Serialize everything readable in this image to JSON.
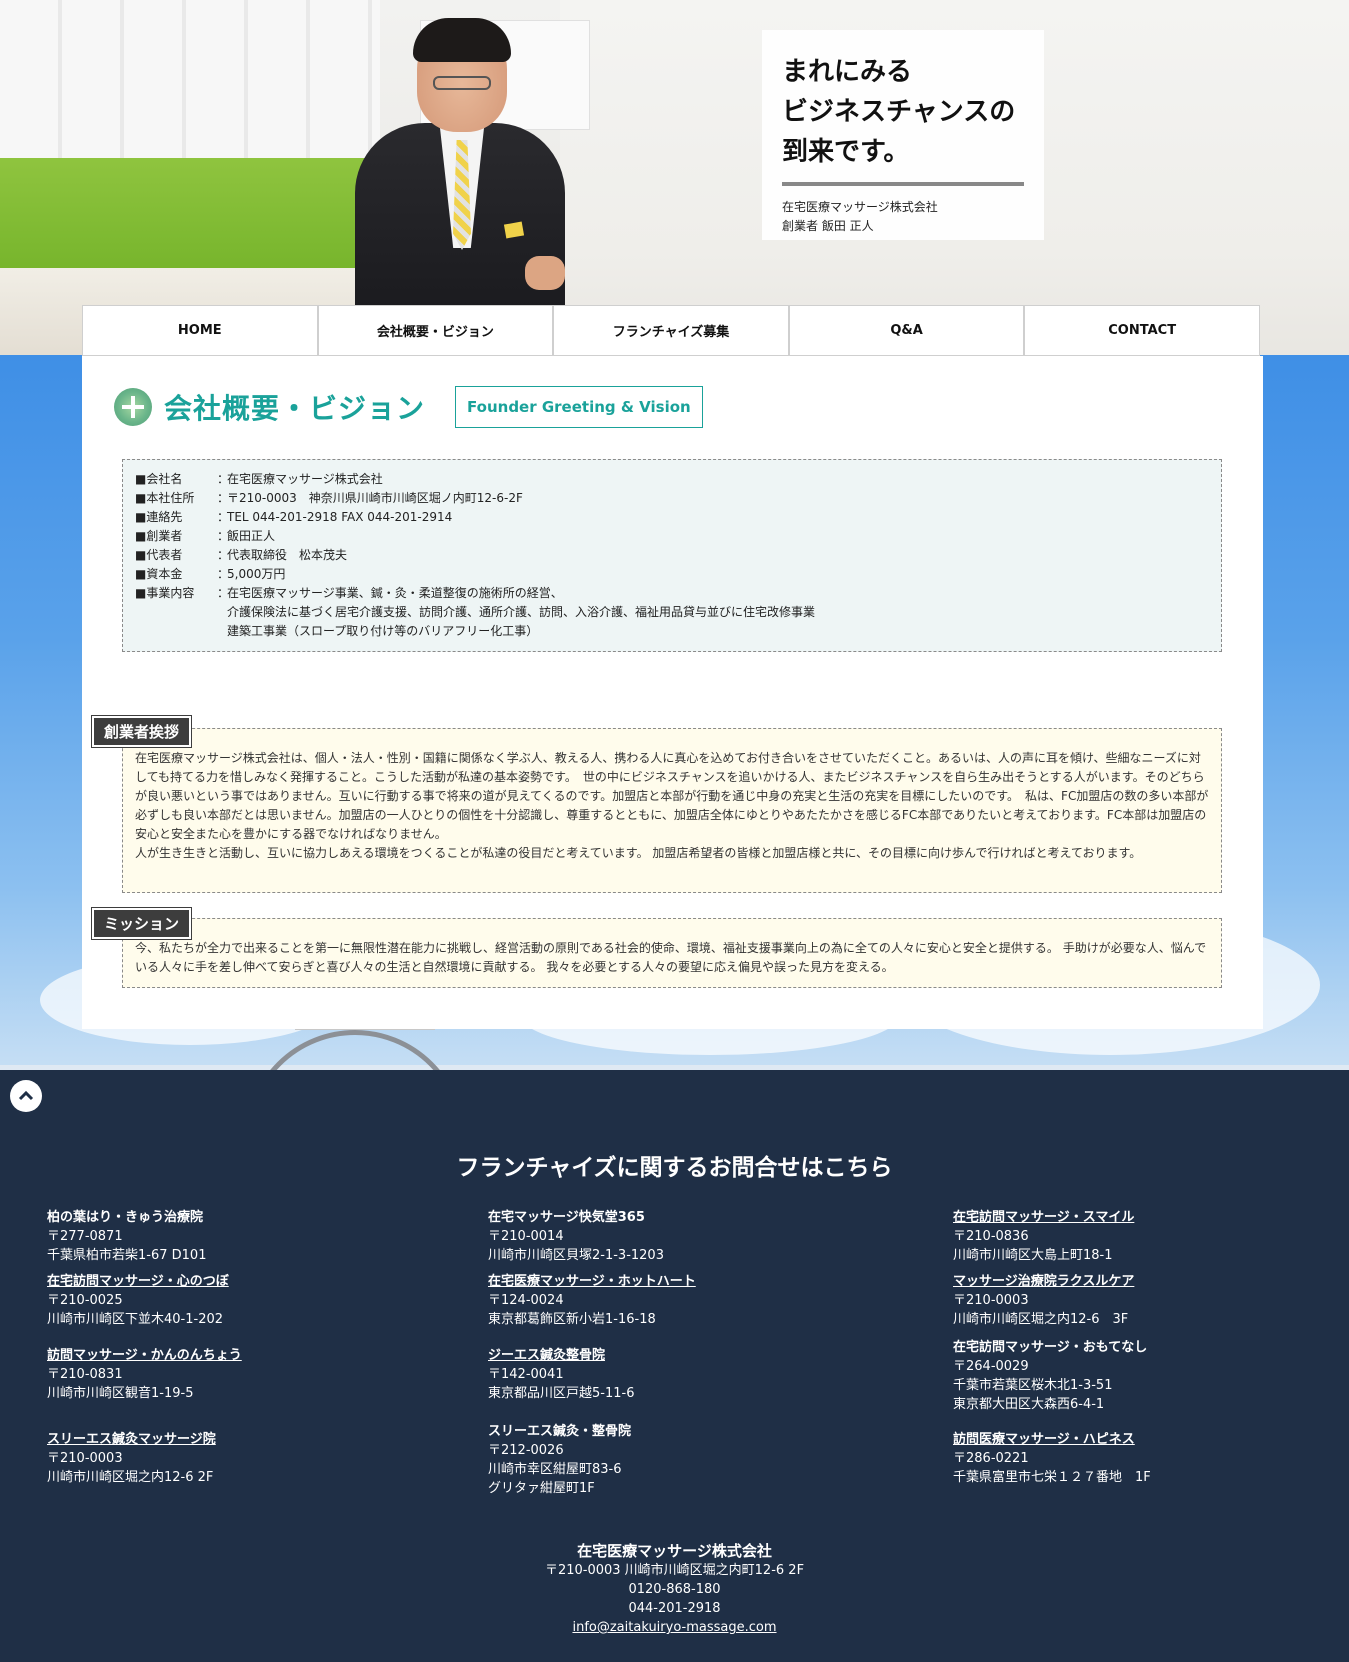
{
  "hero": {
    "headline_lines": [
      "まれにみる",
      "ビジネスチャンスの",
      "到来です。"
    ],
    "company": "在宅医療マッサージ株式会社",
    "founder": "創業者 飯田 正人"
  },
  "nav": {
    "items": [
      "HOME",
      "会社概要・ビジョン",
      "フランチャイズ募集",
      "Q&A",
      "CONTACT"
    ]
  },
  "page": {
    "title": "会社概要・ビジョン",
    "subtitle": "Founder Greeting & Vision"
  },
  "company_info": [
    {
      "key": "■会社名",
      "value": "在宅医療マッサージ株式会社"
    },
    {
      "key": "■本社住所",
      "value": "〒210-0003　神奈川県川崎市川崎区堀ノ内町12-6-2F"
    },
    {
      "key": "■連絡先",
      "value": "TEL 044-201-2918 FAX 044-201-2914"
    },
    {
      "key": "■創業者",
      "value": "飯田正人"
    },
    {
      "key": "■代表者",
      "value": "代表取締役　松本茂夫"
    },
    {
      "key": "■資本金",
      "value": "5,000万円"
    },
    {
      "key": "■事業内容",
      "value": "在宅医療マッサージ事業、鍼・灸・柔道整復の施術所の経営、"
    },
    {
      "key": "",
      "value": "介護保険法に基づく居宅介護支援、訪問介護、通所介護、訪問、入浴介護、福祉用品貸与並びに住宅改修事業"
    },
    {
      "key": "",
      "value": "建築工事業（スロープ取り付け等のバリアフリー化工事）"
    }
  ],
  "greeting": {
    "label": "創業者挨拶",
    "text": "在宅医療マッサージ株式会社は、個人・法人・性別・国籍に関係なく学ぶ人、教える人、携わる人に真心を込めてお付き合いをさせていただくこと。あるいは、人の声に耳を傾け、些細なニーズに対しても持てる力を惜しみなく発揮すること。こうした活動が私達の基本姿勢です。　世の中にビジネスチャンスを追いかける人、またビジネスチャンスを自ら生み出そうとする人がいます。そのどちらが良い悪いという事ではありません。互いに行動する事で将来の道が見えてくるのです。加盟店と本部が行動を通じ中身の充実と生活の充実を目標にしたいのです。　私は、FC加盟店の数の多い本部が必ずしも良い本部だとは思いません。加盟店の一人ひとりの個性を十分認識し、尊重するとともに、加盟店全体にゆとりやあたたかさを感じるFC本部でありたいと考えております。FC本部は加盟店の安心と安全また心を豊かにする器でなければなりません。",
    "text2": "人が生き生きと活動し、互いに協力しあえる環境をつくることが私達の役目だと考えています。 加盟店希望者の皆様と加盟店様と共に、その目標に向け歩んで行ければと考えております。"
  },
  "mission": {
    "label": "ミッション",
    "text": "今、私たちが全力で出来ることを第一に無限性潜在能力に挑戦し、経営活動の原則である社会的使命、環境、福祉支援事業向上の為に全ての人々に安心と安全と提供する。 手助けが必要な人、悩んでいる人々に手を差し伸べて安らぎと喜び人々の生活と自然環境に貢献する。 我々を必要とする人々の要望に応え偏見や誤った見方を変える。"
  },
  "footer": {
    "title": "フランチャイズに関するお問合せはこちら",
    "col1": [
      {
        "name": "柏の葉はり・きゅう治療院",
        "link": false,
        "zip": "〒277-0871",
        "addr": [
          "千葉県柏市若柴1-67 D101"
        ]
      },
      {
        "name": "在宅訪問マッサージ・心のつぼ",
        "link": true,
        "zip": "〒210-0025",
        "addr": [
          "川崎市川崎区下並木40-1-202"
        ]
      },
      {
        "name": "訪問マッサージ・かんのんちょう",
        "link": true,
        "zip": "〒210-0831",
        "addr": [
          "川崎市川崎区観音1-19-5"
        ]
      },
      {
        "name": "スリーエス鍼灸マッサージ院",
        "link": true,
        "zip": "〒210-0003",
        "addr": [
          "川崎市川崎区堀之内12-6 2F"
        ]
      }
    ],
    "col2": [
      {
        "name": "在宅マッサージ快気堂365",
        "link": false,
        "zip": "〒210-0014",
        "addr": [
          "川崎市川崎区貝塚2-1-3-1203"
        ]
      },
      {
        "name": "在宅医療マッサージ・ホットハート",
        "link": true,
        "zip": "〒124-0024",
        "addr": [
          "東京都葛飾区新小岩1-16-18"
        ]
      },
      {
        "name": "ジーエス鍼灸整骨院",
        "link": true,
        "zip": "〒142-0041",
        "addr": [
          "東京都品川区戸越5-11-6"
        ]
      },
      {
        "name": "スリーエス鍼灸・整骨院",
        "link": false,
        "zip": "〒212-0026",
        "addr": [
          "川崎市幸区紺屋町83-6",
          "グリタァ紺屋町1F"
        ]
      }
    ],
    "col3": [
      {
        "name": "在宅訪問マッサージ・スマイル",
        "link": true,
        "zip": "〒210-0836",
        "addr": [
          "川崎市川崎区大島上町18-1"
        ]
      },
      {
        "name": "マッサージ治療院ラクスルケア",
        "link": true,
        "zip": "〒210-0003",
        "addr": [
          "川崎市川崎区堀之内12-6　3F"
        ]
      },
      {
        "name": "在宅訪問マッサージ・おもてなし",
        "link": false,
        "zip": "〒264-0029",
        "addr": [
          "千葉市若葉区桜木北1-3-51",
          "東京都大田区大森西6-4-1"
        ]
      },
      {
        "name": "訪問医療マッサージ・ハピネス",
        "link": true,
        "zip": "〒286-0221",
        "addr": [
          "千葉県富里市七栄１２７番地　1F"
        ]
      }
    ],
    "company": {
      "name": "在宅医療マッサージ株式会社",
      "address": "〒210-0003 川崎市川崎区堀之内町12-6 2F",
      "phone1": "0120-868-180",
      "phone2": "044-201-2918",
      "email": "info@zaitakuiryo-massage.com"
    }
  },
  "icons": {
    "totop": "chevron-up-icon",
    "title": "leaf-cross-icon"
  },
  "colors": {
    "accent": "#1aa29a",
    "footer_bg": "#1f2f46",
    "label_bg": "#3d3d3d",
    "info_bg": "#eef5f5",
    "note_bg": "#fffcec"
  }
}
